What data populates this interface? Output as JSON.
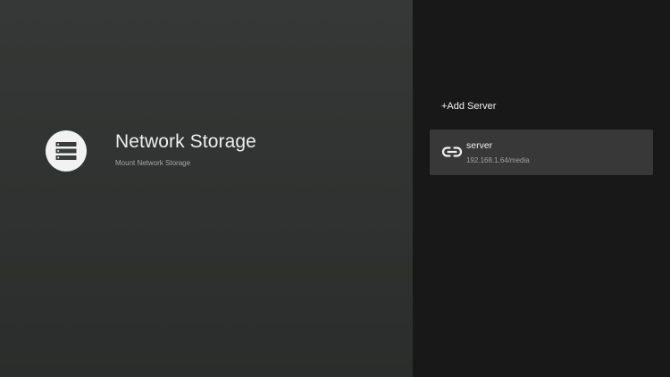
{
  "header": {
    "title": "Network Storage",
    "subtitle": "Mount Network Storage",
    "icon": "server-storage-icon"
  },
  "panel": {
    "add_server_label": "+Add Server",
    "servers": [
      {
        "name": "server",
        "path": "192.168.1.64/media",
        "icon": "link-icon"
      }
    ]
  },
  "colors": {
    "left_background": "#333534",
    "right_background": "#181818",
    "card_background": "#373837",
    "primary_text": "#eeeeee",
    "secondary_text": "#a6a8a6",
    "icon_circle": "#f2f2f2"
  }
}
